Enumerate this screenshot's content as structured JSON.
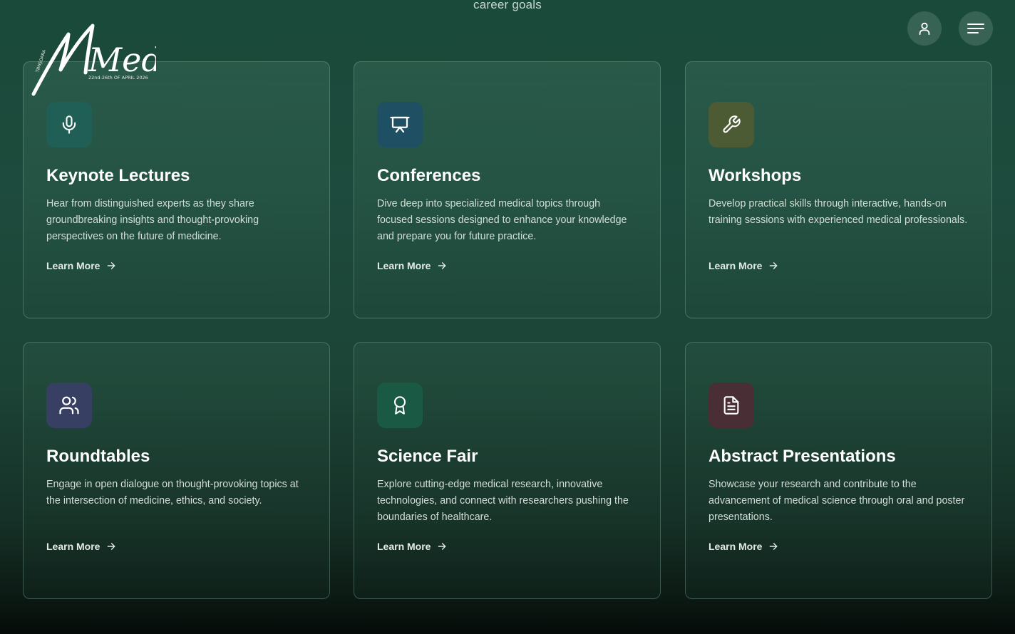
{
  "header": {
    "caption": "career goals",
    "logo": {
      "title": "Medis",
      "prefix": "TIMIȘOARA",
      "dates": "22nd-26th OF APRIL 2026"
    },
    "user_icon": "user-icon",
    "menu_icon": "menu-icon"
  },
  "cards": [
    {
      "title": "Keynote Lectures",
      "description": "Hear from distinguished experts as they share groundbreaking insights and thought-provoking perspectives on the future of medicine.",
      "link": "Learn More",
      "icon": "microphone-icon",
      "icon_bg": "#1f5f55"
    },
    {
      "title": "Conferences",
      "description": "Dive deep into specialized medical topics through focused sessions designed to enhance your knowledge and prepare you for future practice.",
      "link": "Learn More",
      "icon": "presentation-icon",
      "icon_bg": "#1f4f63"
    },
    {
      "title": "Workshops",
      "description": "Develop practical skills through interactive, hands-on training sessions with experienced medical professionals.",
      "link": "Learn More",
      "icon": "wrench-icon",
      "icon_bg": "#4d5b35"
    },
    {
      "title": "Roundtables",
      "description": "Engage in open dialogue on thought-provoking topics at the intersection of medicine, ethics, and society.",
      "link": "Learn More",
      "icon": "users-icon",
      "icon_bg": "#373f63"
    },
    {
      "title": "Science Fair",
      "description": "Explore cutting-edge medical research, innovative technologies, and connect with researchers pushing the boundaries of healthcare.",
      "link": "Learn More",
      "icon": "award-icon",
      "icon_bg": "#1a5a45"
    },
    {
      "title": "Abstract Presentations",
      "description": "Showcase your research and contribute to the advancement of medical science through oral and poster presentations.",
      "link": "Learn More",
      "icon": "file-text-icon",
      "icon_bg": "#4a2e35"
    }
  ]
}
